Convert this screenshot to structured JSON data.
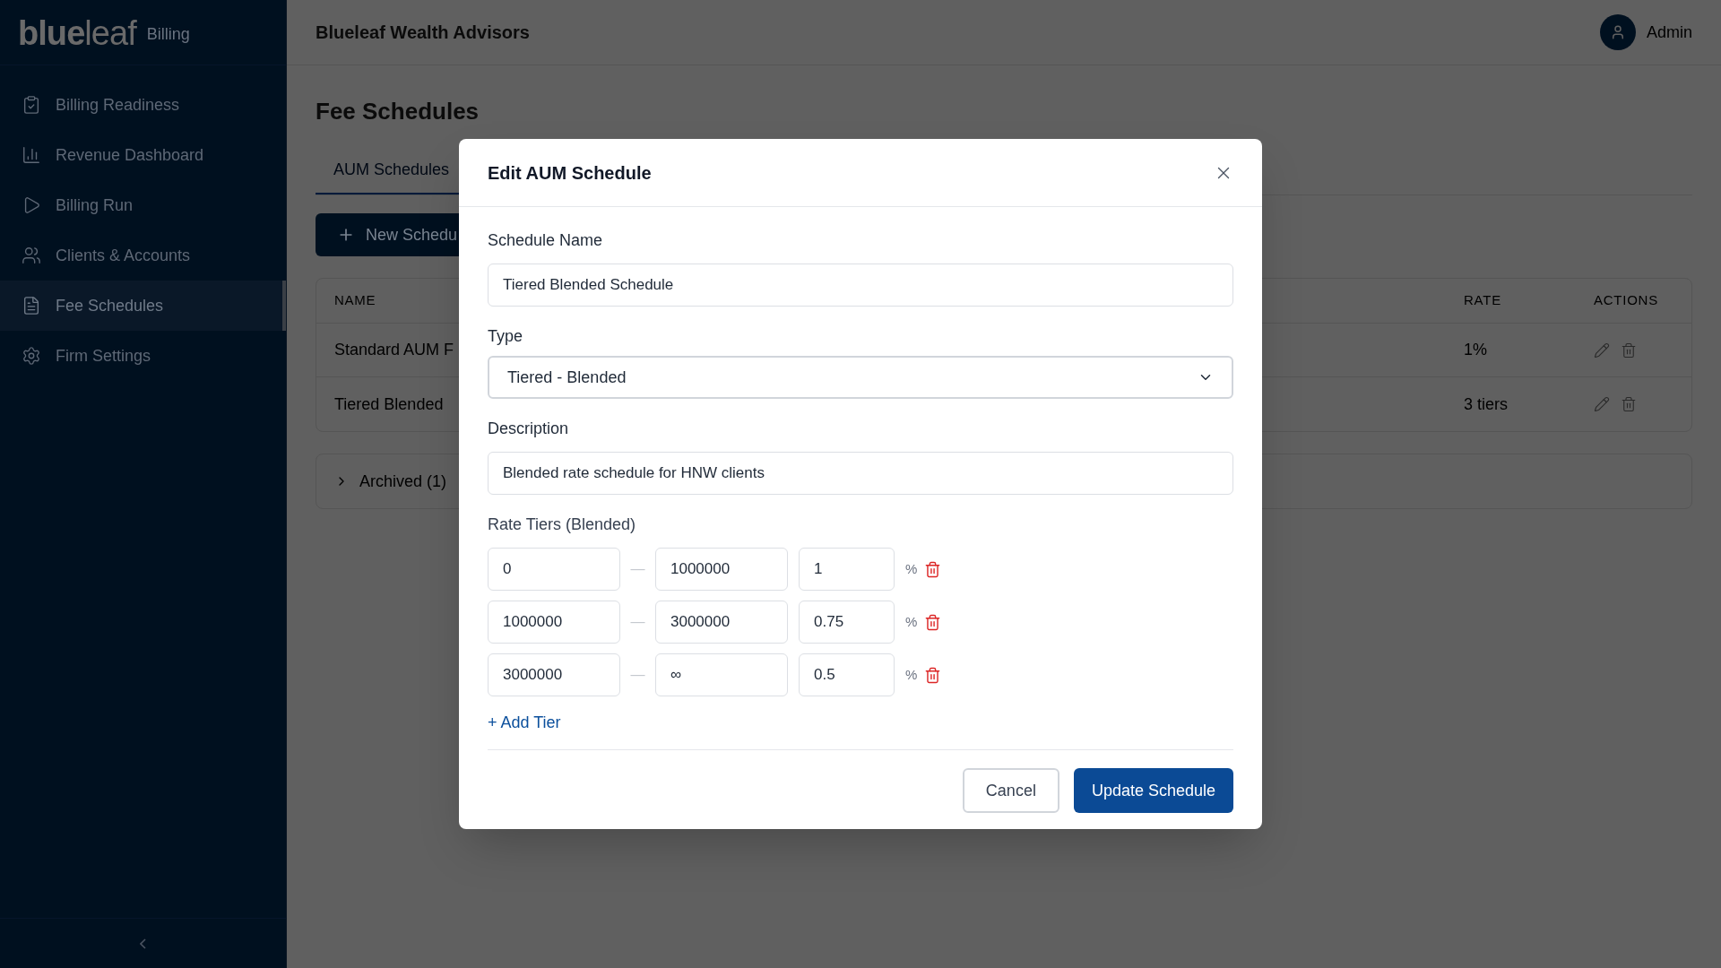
{
  "sidebar": {
    "logo": "**blue**leaf",
    "product": "Billing",
    "items": [
      {
        "label": "Billing Readiness",
        "selected": false
      },
      {
        "label": "Revenue Dashboard",
        "selected": false
      },
      {
        "label": "Billing Run",
        "selected": false
      },
      {
        "label": "Clients & Accounts",
        "selected": false
      },
      {
        "label": "Fee Schedules",
        "selected": true
      },
      {
        "label": "Firm Settings",
        "selected": false
      }
    ]
  },
  "header": {
    "title": "Blueleaf Wealth Advisors",
    "user": "Admin"
  },
  "page": {
    "title": "Fee Schedules",
    "tabs": [
      {
        "label": "AUM Schedules",
        "selected": true
      }
    ],
    "new_button": "New Schedu",
    "table": {
      "columns": [
        "NAME",
        "RATE",
        "ACTIONS"
      ],
      "rows": [
        {
          "name": "Standard AUM F",
          "rate": "1%"
        },
        {
          "name": "Tiered Blended",
          "rate": "3 tiers"
        }
      ]
    },
    "archived": {
      "label": "Archived (1)",
      "expanded": false
    }
  },
  "modal": {
    "title": "Edit AUM Schedule",
    "name_label": "Schedule Name",
    "name_value": "Tiered Blended Schedule",
    "type_label": "Type",
    "type_value": "Tiered - Blended",
    "description_label": "Description",
    "description_value": "Blended rate schedule for HNW clients",
    "tiers_label": "Rate Tiers (Blended)",
    "tiers": [
      {
        "from": "0",
        "separator": "—",
        "to": "1000000",
        "rate": "1",
        "unit": "%"
      },
      {
        "from": "1000000",
        "separator": "—",
        "to": "3000000",
        "rate": "0.75",
        "unit": "%"
      },
      {
        "from": "3000000",
        "separator": "—",
        "to": "∞",
        "rate": "0.5",
        "unit": "%"
      }
    ],
    "add_tier": "+ Add Tier",
    "cancel": "Cancel",
    "submit": "Update Schedule"
  }
}
